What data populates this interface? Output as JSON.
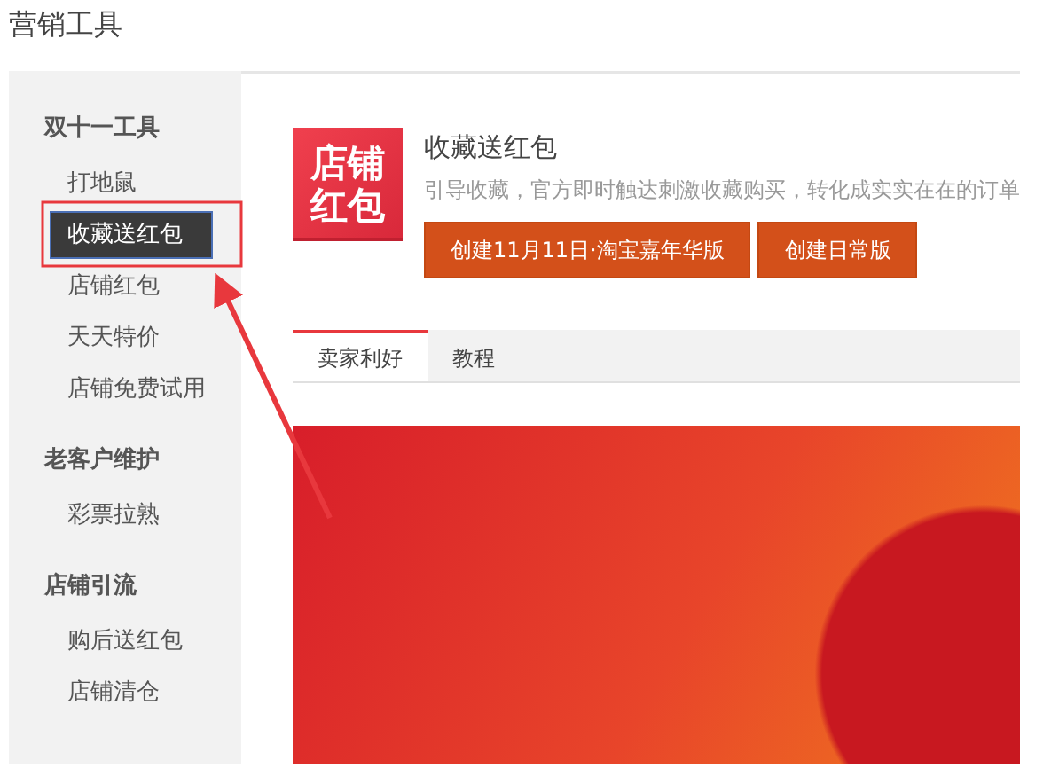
{
  "page_title": "营销工具",
  "sidebar": {
    "groups": [
      {
        "heading": "双十一工具",
        "items": [
          {
            "label": "打地鼠",
            "selected": false
          },
          {
            "label": "收藏送红包",
            "selected": true
          },
          {
            "label": "店铺红包",
            "selected": false
          },
          {
            "label": "天天特价",
            "selected": false
          },
          {
            "label": "店铺免费试用",
            "selected": false
          }
        ]
      },
      {
        "heading": "老客户维护",
        "items": [
          {
            "label": "彩票拉熟",
            "selected": false
          }
        ]
      },
      {
        "heading": "店铺引流",
        "items": [
          {
            "label": "购后送红包",
            "selected": false
          },
          {
            "label": "店铺清仓",
            "selected": false
          }
        ]
      }
    ]
  },
  "tool": {
    "logo_lines": [
      "店铺",
      "红包"
    ],
    "title": "收藏送红包",
    "description": "引导收藏，官方即时触达刺激收藏购买，转化成实实在在的订单",
    "buttons": [
      "创建11月11日·淘宝嘉年华版",
      "创建日常版"
    ]
  },
  "tabs": [
    {
      "label": "卖家利好",
      "selected": true
    },
    {
      "label": "教程",
      "selected": false
    }
  ]
}
